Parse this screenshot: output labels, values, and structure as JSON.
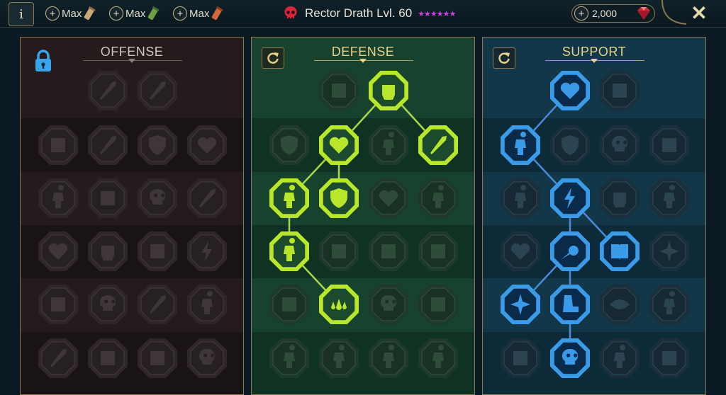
{
  "topbar": {
    "info_label": "i",
    "resources": [
      {
        "label": "Max",
        "scroll_color": "#c8a878"
      },
      {
        "label": "Max",
        "scroll_color": "#6ea042"
      },
      {
        "label": "Max",
        "scroll_color": "#d0683a"
      }
    ],
    "champion_title": "Rector Drath Lvl. 60",
    "stars": "★★★★★★",
    "gems": "2,000",
    "close_label": "✕"
  },
  "colors": {
    "gold": "#e7d28a",
    "frame": "#8a7a52",
    "defense_active": "#b8e62a",
    "support_active": "#3a9ce8",
    "locked_node": "#2e2a2c",
    "defense_bg": "#123a27",
    "support_bg": "#0f3041",
    "offense_bg": "#1d1517"
  },
  "panels": {
    "offense": {
      "title": "OFFENSE",
      "locked": true,
      "nodes": [
        {
          "row": 0,
          "col": 1,
          "icon": "crossed-swords-icon",
          "active": false
        },
        {
          "row": 0,
          "col": 2,
          "icon": "slash-marks-icon",
          "active": false
        },
        {
          "row": 1,
          "col": 0,
          "icon": "horned-demon-icon",
          "active": false
        },
        {
          "row": 1,
          "col": 1,
          "icon": "sword-strike-icon",
          "active": false
        },
        {
          "row": 1,
          "col": 2,
          "icon": "shield-breaker-icon",
          "active": false
        },
        {
          "row": 1,
          "col": 3,
          "icon": "pierced-heart-icon",
          "active": false
        },
        {
          "row": 2,
          "col": 0,
          "icon": "warrior-icon",
          "active": false
        },
        {
          "row": 2,
          "col": 1,
          "icon": "fangs-icon",
          "active": false
        },
        {
          "row": 2,
          "col": 2,
          "icon": "skull-slash-icon",
          "active": false
        },
        {
          "row": 2,
          "col": 3,
          "icon": "axe-icon",
          "active": false
        },
        {
          "row": 3,
          "col": 0,
          "icon": "heart-blade-icon",
          "active": false
        },
        {
          "row": 3,
          "col": 1,
          "icon": "power-fist-icon",
          "active": false
        },
        {
          "row": 3,
          "col": 2,
          "icon": "hammer-icon",
          "active": false
        },
        {
          "row": 3,
          "col": 3,
          "icon": "lightning-chain-icon",
          "active": false
        },
        {
          "row": 4,
          "col": 0,
          "icon": "claws-icon",
          "active": false
        },
        {
          "row": 4,
          "col": 1,
          "icon": "skull-icon",
          "active": false
        },
        {
          "row": 4,
          "col": 2,
          "icon": "blade-icon",
          "active": false
        },
        {
          "row": 4,
          "col": 3,
          "icon": "brute-icon",
          "active": false
        },
        {
          "row": 5,
          "col": 0,
          "icon": "great-sword-icon",
          "active": false
        },
        {
          "row": 5,
          "col": 1,
          "icon": "knight-helm-icon",
          "active": false
        },
        {
          "row": 5,
          "col": 2,
          "icon": "beast-icon",
          "active": false
        },
        {
          "row": 5,
          "col": 3,
          "icon": "skull-crown-icon",
          "active": false
        }
      ],
      "links": []
    },
    "defense": {
      "title": "DEFENSE",
      "locked": false,
      "nodes": [
        {
          "row": 0,
          "col": 1,
          "icon": "armor-plates-icon",
          "active": false
        },
        {
          "row": 0,
          "col": 2,
          "icon": "raised-fist-icon",
          "active": true
        },
        {
          "row": 1,
          "col": 0,
          "icon": "chevron-shield-icon",
          "active": false
        },
        {
          "row": 1,
          "col": 1,
          "icon": "heart-flask-icon",
          "active": true
        },
        {
          "row": 1,
          "col": 2,
          "icon": "strongman-icon",
          "active": false
        },
        {
          "row": 1,
          "col": 3,
          "icon": "deflect-blade-icon",
          "active": true
        },
        {
          "row": 2,
          "col": 0,
          "icon": "dancer-icon",
          "active": true
        },
        {
          "row": 2,
          "col": 1,
          "icon": "knight-shield-icon",
          "active": true
        },
        {
          "row": 2,
          "col": 2,
          "icon": "heart-icon",
          "active": false
        },
        {
          "row": 2,
          "col": 3,
          "icon": "hooded-figure-icon",
          "active": false
        },
        {
          "row": 3,
          "col": 0,
          "icon": "cheering-crowd-icon",
          "active": true
        },
        {
          "row": 3,
          "col": 1,
          "icon": "hourglass-icon",
          "active": false
        },
        {
          "row": 3,
          "col": 2,
          "icon": "open-hand-icon",
          "active": false
        },
        {
          "row": 3,
          "col": 3,
          "icon": "bull-icon",
          "active": false
        },
        {
          "row": 4,
          "col": 0,
          "icon": "dash-icon",
          "active": false
        },
        {
          "row": 4,
          "col": 1,
          "icon": "drops-icon",
          "active": true
        },
        {
          "row": 4,
          "col": 2,
          "icon": "skull-icon",
          "active": false
        },
        {
          "row": 4,
          "col": 3,
          "icon": "ward-icon",
          "active": false
        },
        {
          "row": 5,
          "col": 0,
          "icon": "thinker-icon",
          "active": false
        },
        {
          "row": 5,
          "col": 1,
          "icon": "berserker-icon",
          "active": false
        },
        {
          "row": 5,
          "col": 2,
          "icon": "dwarf-icon",
          "active": false
        },
        {
          "row": 5,
          "col": 3,
          "icon": "ghost-icon",
          "active": false
        }
      ],
      "links": [
        [
          0,
          2,
          1,
          1
        ],
        [
          0,
          2,
          1,
          3
        ],
        [
          1,
          1,
          2,
          0
        ],
        [
          1,
          1,
          2,
          1
        ],
        [
          2,
          0,
          3,
          0
        ],
        [
          3,
          0,
          4,
          1
        ]
      ]
    },
    "support": {
      "title": "SUPPORT",
      "locked": false,
      "nodes": [
        {
          "row": 0,
          "col": 1,
          "icon": "healing-heart-icon",
          "active": true
        },
        {
          "row": 0,
          "col": 2,
          "icon": "swirl-icon",
          "active": false
        },
        {
          "row": 1,
          "col": 0,
          "icon": "praying-hands-icon",
          "active": true
        },
        {
          "row": 1,
          "col": 1,
          "icon": "dome-shield-icon",
          "active": false
        },
        {
          "row": 1,
          "col": 2,
          "icon": "skull-fire-icon",
          "active": false
        },
        {
          "row": 1,
          "col": 3,
          "icon": "wind-arrows-icon",
          "active": false
        },
        {
          "row": 2,
          "col": 0,
          "icon": "warrior-glow-icon",
          "active": false
        },
        {
          "row": 2,
          "col": 1,
          "icon": "lightning-refresh-icon",
          "active": true
        },
        {
          "row": 2,
          "col": 2,
          "icon": "stone-fist-icon",
          "active": false
        },
        {
          "row": 2,
          "col": 3,
          "icon": "figure-icon",
          "active": false
        },
        {
          "row": 3,
          "col": 0,
          "icon": "chained-heart-icon",
          "active": false
        },
        {
          "row": 3,
          "col": 1,
          "icon": "comet-icon",
          "active": true
        },
        {
          "row": 3,
          "col": 2,
          "icon": "spell-book-icon",
          "active": true
        },
        {
          "row": 3,
          "col": 3,
          "icon": "burst-icon",
          "active": false
        },
        {
          "row": 4,
          "col": 0,
          "icon": "compass-star-icon",
          "active": true
        },
        {
          "row": 4,
          "col": 1,
          "icon": "speed-boot-icon",
          "active": true
        },
        {
          "row": 4,
          "col": 2,
          "icon": "all-seeing-eye-icon",
          "active": false
        },
        {
          "row": 4,
          "col": 3,
          "icon": "martial-artist-icon",
          "active": false
        },
        {
          "row": 5,
          "col": 0,
          "icon": "bomb-icon",
          "active": false
        },
        {
          "row": 5,
          "col": 1,
          "icon": "screaming-skull-icon",
          "active": true
        },
        {
          "row": 5,
          "col": 2,
          "icon": "idol-icon",
          "active": false
        },
        {
          "row": 5,
          "col": 3,
          "icon": "eagle-icon",
          "active": false
        }
      ],
      "links": [
        [
          0,
          1,
          1,
          0
        ],
        [
          1,
          0,
          2,
          1
        ],
        [
          2,
          1,
          3,
          1
        ],
        [
          2,
          1,
          3,
          2
        ],
        [
          3,
          1,
          4,
          0
        ],
        [
          3,
          1,
          4,
          1
        ],
        [
          4,
          1,
          5,
          1
        ]
      ]
    }
  }
}
